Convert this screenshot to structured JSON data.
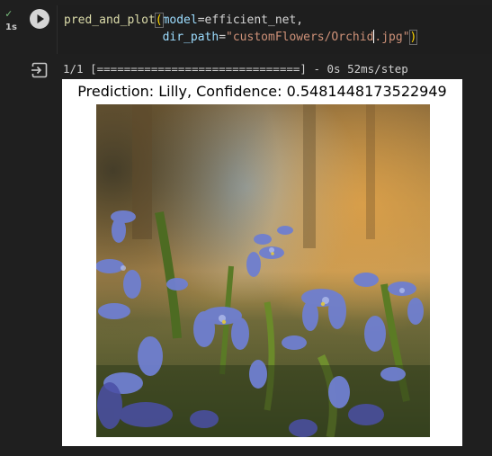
{
  "cell": {
    "status_icon": "check-icon",
    "exec_time": "1s",
    "run_icon": "play-icon",
    "code_line1": {
      "fn": "pred_and_plot",
      "paren_open": "(",
      "param1": "model",
      "eq1": "=",
      "value1": "efficient_net,"
    },
    "code_line2": {
      "param2": "dir_path",
      "eq2": "=",
      "str_before_cursor": "\"customFlowers/Orchid",
      "str_after_cursor": ".jpg\"",
      "paren_close": ")"
    }
  },
  "output": {
    "output_icon": "output-arrow-icon",
    "progress": "1/1 [==============================] - 0s 52ms/step",
    "figure_title": "Prediction: Lilly, Confidence: 0.5481448173522949",
    "image_subject": "blue-flowers-photo"
  },
  "colors": {
    "background": "#1f1f1f",
    "function": "#dcdcaa",
    "string": "#ce9178",
    "bracket": "#ffd700",
    "success": "#7bc47f"
  }
}
